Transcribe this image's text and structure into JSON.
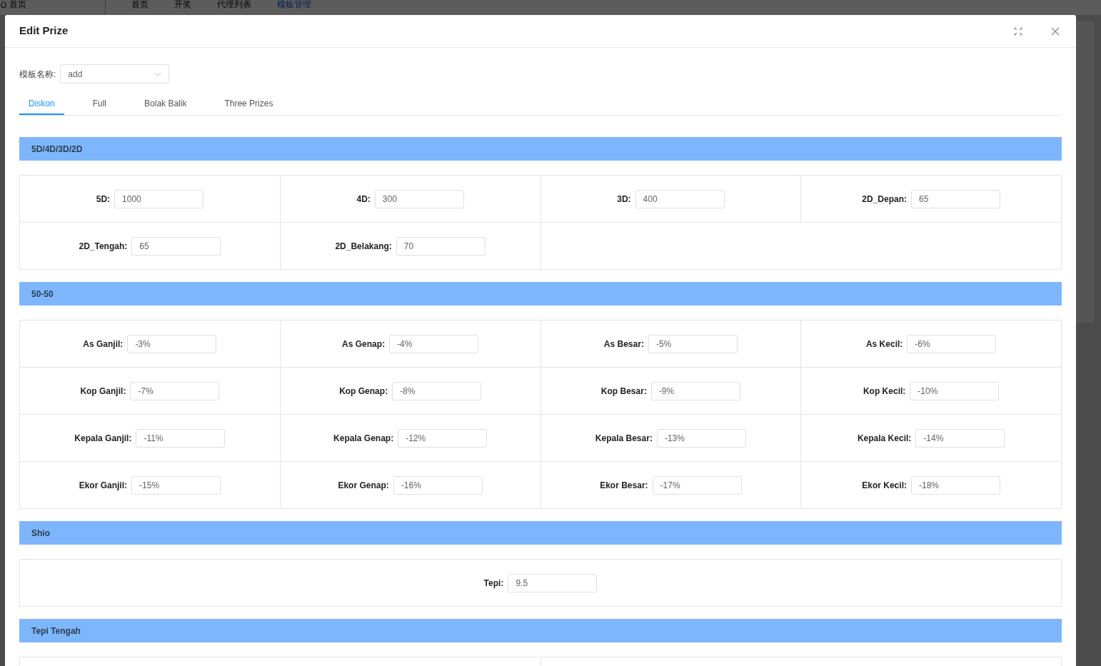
{
  "nav": {
    "home": "首页",
    "items": [
      {
        "label": "首页",
        "selected": false
      },
      {
        "label": "开奖",
        "selected": false
      },
      {
        "label": "代理列表",
        "selected": false
      },
      {
        "label": "模板管理",
        "selected": true
      }
    ]
  },
  "dialog": {
    "title": "Edit Prize",
    "template": {
      "label": "模板名称:",
      "value": "add"
    },
    "tabs": [
      {
        "label": "Diskon",
        "selected": true
      },
      {
        "label": "Full",
        "selected": false
      },
      {
        "label": "Bolak Balik",
        "selected": false
      },
      {
        "label": "Three Prizes",
        "selected": false
      }
    ],
    "sections": [
      {
        "title": "5D/4D/3D/2D",
        "kind": "quad",
        "fields": [
          {
            "label": "5D:",
            "value": "1000"
          },
          {
            "label": "4D:",
            "value": "300"
          },
          {
            "label": "3D:",
            "value": "400"
          },
          {
            "label": "2D_Depan:",
            "value": "65"
          },
          {
            "label": "2D_Tengah:",
            "value": "65"
          },
          {
            "label": "2D_Belakang:",
            "value": "70"
          }
        ]
      },
      {
        "title": "50-50",
        "kind": "quad",
        "fields": [
          {
            "label": "As Ganjil:",
            "value": "-3%"
          },
          {
            "label": "As Genap:",
            "value": "-4%"
          },
          {
            "label": "As Besar:",
            "value": "-5%"
          },
          {
            "label": "As Kecil:",
            "value": "-6%"
          },
          {
            "label": "Kop Ganjil:",
            "value": "-7%"
          },
          {
            "label": "Kop Genap:",
            "value": "-8%"
          },
          {
            "label": "Kop Besar:",
            "value": "-9%"
          },
          {
            "label": "Kop Kecil:",
            "value": "-10%"
          },
          {
            "label": "Kepala Ganjil:",
            "value": "-11%"
          },
          {
            "label": "Kepala Genap:",
            "value": "-12%"
          },
          {
            "label": "Kepala Besar:",
            "value": "-13%"
          },
          {
            "label": "Kepala Kecil:",
            "value": "-14%"
          },
          {
            "label": "Ekor Ganjil:",
            "value": "-15%"
          },
          {
            "label": "Ekor Genap:",
            "value": "-16%"
          },
          {
            "label": "Ekor Besar:",
            "value": "-17%"
          },
          {
            "label": "Ekor Kecil:",
            "value": "-18%"
          }
        ]
      },
      {
        "title": "Shio",
        "kind": "single",
        "fields": [
          {
            "label": "Tepi:",
            "value": "9.5"
          }
        ]
      },
      {
        "title": "Tepi Tengah",
        "kind": "pair"
      }
    ]
  }
}
